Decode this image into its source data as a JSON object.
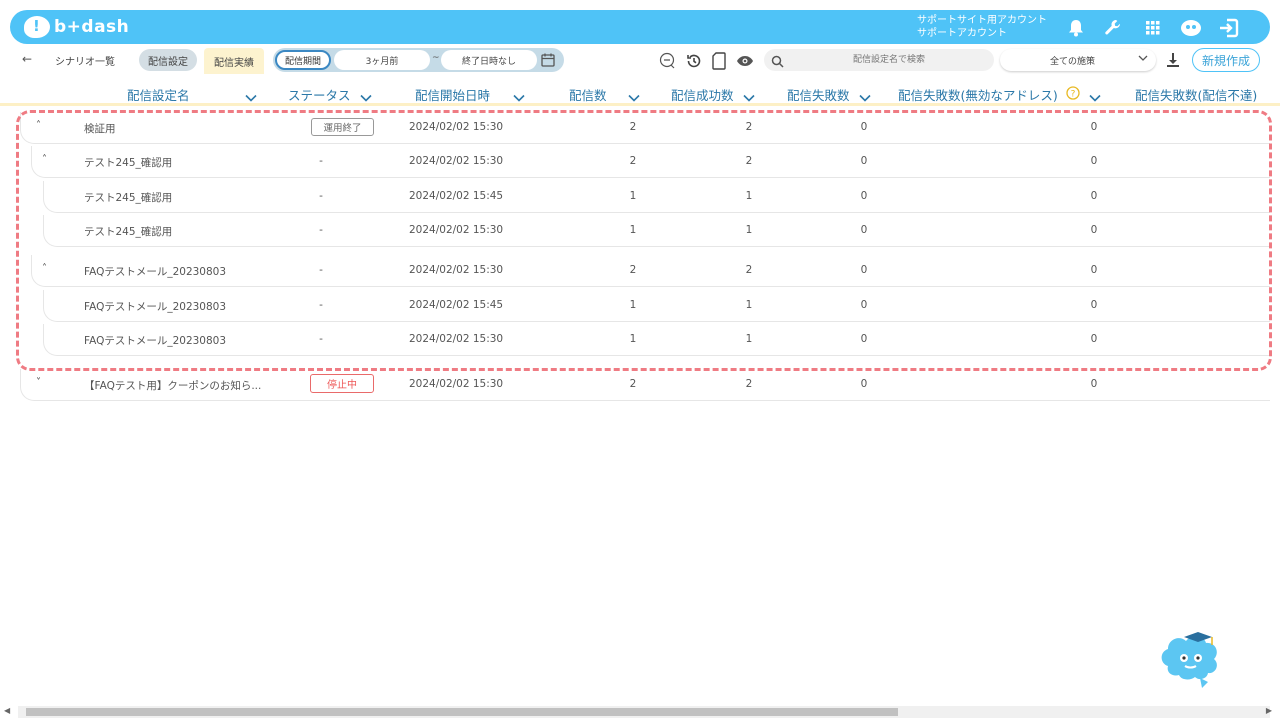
{
  "header": {
    "logo_text": "b+dash",
    "account_line1": "サポートサイト用アカウント",
    "account_line2": "サポートアカウント",
    "icons": [
      "bell-icon",
      "wrench-icon",
      "grid-icon",
      "mascot-icon",
      "logout-icon"
    ]
  },
  "toolbar": {
    "back": "←",
    "breadcrumb": "シナリオ一覧",
    "tab_settings": "配信設定",
    "tab_results": "配信実績",
    "period_label": "配信期間",
    "period_start": "3ヶ月前",
    "period_sep": "~",
    "period_end": "終了日時なし",
    "search_placeholder": "配信設定名で検索",
    "filter_value": "全ての施策",
    "new_button": "新規作成"
  },
  "table": {
    "columns": [
      "配信設定名",
      "ステータス",
      "配信開始日時",
      "配信数",
      "配信成功数",
      "配信失敗数",
      "配信失敗数(無効なアドレス)",
      "配信失敗数(配信不達)"
    ],
    "rows": [
      {
        "toggle": "˄",
        "name": "検証用",
        "status": "運用終了",
        "date": "2024/02/02 15:30",
        "sent": "2",
        "success": "2",
        "fail": "0",
        "invalid": "0"
      },
      {
        "toggle": "˄",
        "name": "テスト245_確認用",
        "status": "-",
        "date": "2024/02/02 15:30",
        "sent": "2",
        "success": "2",
        "fail": "0",
        "invalid": "0"
      },
      {
        "toggle": "",
        "name": "テスト245_確認用",
        "status": "-",
        "date": "2024/02/02 15:45",
        "sent": "1",
        "success": "1",
        "fail": "0",
        "invalid": "0"
      },
      {
        "toggle": "",
        "name": "テスト245_確認用",
        "status": "-",
        "date": "2024/02/02 15:30",
        "sent": "1",
        "success": "1",
        "fail": "0",
        "invalid": "0"
      },
      {
        "toggle": "˄",
        "name": "FAQテストメール_20230803",
        "status": "-",
        "date": "2024/02/02 15:30",
        "sent": "2",
        "success": "2",
        "fail": "0",
        "invalid": "0"
      },
      {
        "toggle": "",
        "name": "FAQテストメール_20230803",
        "status": "-",
        "date": "2024/02/02 15:45",
        "sent": "1",
        "success": "1",
        "fail": "0",
        "invalid": "0"
      },
      {
        "toggle": "",
        "name": "FAQテストメール_20230803",
        "status": "-",
        "date": "2024/02/02 15:30",
        "sent": "1",
        "success": "1",
        "fail": "0",
        "invalid": "0"
      },
      {
        "toggle": "˅",
        "name": "【FAQテスト用】クーポンのお知ら...",
        "status": "停止中",
        "date": "2024/02/02 15:30",
        "sent": "2",
        "success": "2",
        "fail": "0",
        "invalid": "0"
      }
    ]
  },
  "colors": {
    "brand": "#4fc3f7",
    "header_text": "#2b78a8",
    "highlight": "#ef7b83",
    "stopped": "#e55555"
  }
}
